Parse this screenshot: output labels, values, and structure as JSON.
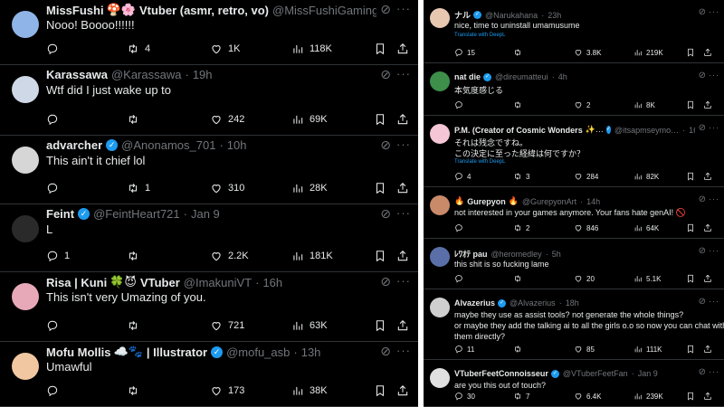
{
  "left": {
    "tweets": [
      {
        "name": "MissFushi",
        "name_emoji": "🍄🌸",
        "name_suffix": "Vtuber (asmr, retro, vo)",
        "verified": false,
        "handle": "@MissFushiGaming",
        "time": "21h",
        "body": "Nooo! Boooo!!!!!!",
        "replies": "",
        "reposts": "4",
        "likes": "1K",
        "views": "118K",
        "avatar_color": "#8fb4e8"
      },
      {
        "name": "Karassawa",
        "name_emoji": "",
        "name_suffix": "",
        "verified": false,
        "handle": "@Karassawa",
        "time": "19h",
        "body": "Wtf did I just wake up to",
        "replies": "",
        "reposts": "",
        "likes": "242",
        "views": "69K",
        "avatar_color": "#cfd8e6"
      },
      {
        "name": "advarcher",
        "name_emoji": "",
        "name_suffix": "",
        "verified": true,
        "handle": "@Anonamos_701",
        "time": "10h",
        "body": "This ain't it chief lol",
        "replies": "",
        "reposts": "1",
        "likes": "310",
        "views": "28K",
        "avatar_color": "#d6d6d6"
      },
      {
        "name": "Feint",
        "name_emoji": "",
        "name_suffix": "",
        "verified": true,
        "handle": "@FeintHeart721",
        "time": "Jan 9",
        "body": "L",
        "replies": "1",
        "reposts": "",
        "likes": "2.2K",
        "views": "181K",
        "avatar_color": "#2a2a2a"
      },
      {
        "name": "Risa | Kuni",
        "name_emoji": "🍀😈",
        "name_suffix": "VTuber",
        "verified": false,
        "handle": "@ImakuniVT",
        "time": "16h",
        "body": "This isn't very Umazing of you.",
        "replies": "",
        "reposts": "",
        "likes": "721",
        "views": "63K",
        "avatar_color": "#e7a9b8"
      },
      {
        "name": "Mofu Mollis",
        "name_emoji": "☁️🐾",
        "name_suffix": "| Illustrator",
        "verified": true,
        "handle": "@mofu_asb",
        "time": "13h",
        "body": "Umawful",
        "replies": "",
        "reposts": "",
        "likes": "173",
        "views": "38K",
        "avatar_color": "#f1c7a1"
      }
    ]
  },
  "right": {
    "tweets": [
      {
        "name": "ナル",
        "name_emoji": "",
        "name_suffix": "",
        "verified": true,
        "handle": "@Narukahana",
        "time": "23h",
        "body_lines": [
          "nice, time to uninstall umamusume"
        ],
        "translate": "Translate with DeepL",
        "replies": "15",
        "reposts": "",
        "likes": "3.8K",
        "views": "219K",
        "avatar_color": "#e8c7b0"
      },
      {
        "name": "nat die",
        "name_emoji": "",
        "name_suffix": "",
        "verified": true,
        "handle": "@direumatteui",
        "time": "4h",
        "body_lines": [
          "本気度感じる"
        ],
        "translate": "",
        "replies": "",
        "reposts": "",
        "likes": "2",
        "views": "8K",
        "avatar_color": "#3d8f4a"
      },
      {
        "name": "P.M. (Creator of Cosmic Wonders",
        "name_emoji": "✨…",
        "name_suffix": "",
        "verified": true,
        "handle": "@itsapmseymo…",
        "time": "16h",
        "body_lines": [
          "それは残念ですね。",
          "この決定に至った経緯は何ですか？"
        ],
        "translate": "Translate with DeepL",
        "replies": "4",
        "reposts": "3",
        "likes": "284",
        "views": "82K",
        "avatar_color": "#f4c6d6"
      },
      {
        "name": "Gurepyon",
        "name_emoji": "🔥",
        "name_prefix_emoji": "🔥",
        "name_suffix": "",
        "verified": false,
        "handle": "@GurepyonArt",
        "time": "14h",
        "body_lines": [
          "not interested in your games anymore. Your fans hate genAI! 🚫"
        ],
        "translate": "",
        "replies": "",
        "reposts": "2",
        "likes": "846",
        "views": "64K",
        "avatar_color": "#c98a6a"
      },
      {
        "name": "ﾚﾜｵﾃ pau",
        "name_emoji": "",
        "name_suffix": "",
        "verified": false,
        "handle": "@heromedley",
        "time": "5h",
        "body_lines": [
          "this shit is so fucking lame"
        ],
        "translate": "",
        "replies": "",
        "reposts": "",
        "likes": "20",
        "views": "5.1K",
        "avatar_color": "#5a6fa8"
      },
      {
        "name": "Alvazerius",
        "name_emoji": "",
        "name_suffix": "",
        "verified": true,
        "handle": "@Alvazerius",
        "time": "18h",
        "body_lines": [
          "maybe they use as assist tools? not generate the whole things?",
          "or maybe they add the talking ai to all the girls o.o so now you can chat with",
          "them directly?"
        ],
        "translate": "",
        "replies": "11",
        "reposts": "",
        "likes": "85",
        "views": "111K",
        "avatar_color": "#cfcfcf"
      },
      {
        "name": "VTuberFeetConnoisseur",
        "name_emoji": "",
        "name_suffix": "",
        "verified": true,
        "handle": "@VTuberFeetFan",
        "time": "Jan 9",
        "body_lines": [
          "are you this out of touch?"
        ],
        "translate": "",
        "replies": "30",
        "reposts": "7",
        "likes": "6.4K",
        "views": "239K",
        "avatar_color": "#e0e0e0"
      }
    ]
  },
  "icons": {
    "reply": "reply-icon",
    "repost": "repost-icon",
    "like": "like-icon",
    "views": "views-icon",
    "bookmark": "bookmark-icon",
    "share": "share-icon",
    "grok": "grok-icon",
    "more": "more-icon",
    "verified": "verified-badge-icon"
  },
  "colors": {
    "background": "#000000",
    "text": "#e7e9ea",
    "muted": "#71767b",
    "accent": "#1d9bf0",
    "divider": "#2f3336"
  },
  "labels": {
    "more": "···",
    "verified_glyph": "✓",
    "grok_glyph": "⊘",
    "sep": "·"
  }
}
